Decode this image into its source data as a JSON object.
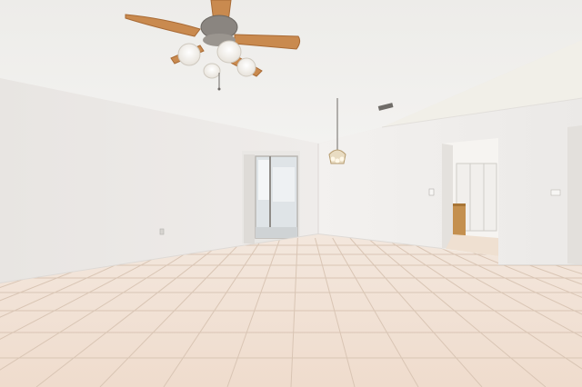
{
  "photo": {
    "subject": "empty room",
    "palette": {
      "ceiling": "#f0efed",
      "wall_left": "#ebe8e5",
      "wall_right": "#f1efed",
      "floor_light": "#f4e6da",
      "floor_dark": "#e2cdbb",
      "grout": "#d6c2b2",
      "fan_blade": "#c98a4f",
      "fan_blade_dark": "#a86a35",
      "fan_metal": "#8a8580",
      "glass": "#f8f6f2",
      "window": "#dfe6ea",
      "wood_cabinet": "#c4904f"
    },
    "objects": [
      "ceiling-fan-icon",
      "pendant-chandelier-icon",
      "sliding-glass-door",
      "doorway-to-hall",
      "wall-switch",
      "outlet",
      "ceiling-vent"
    ]
  }
}
